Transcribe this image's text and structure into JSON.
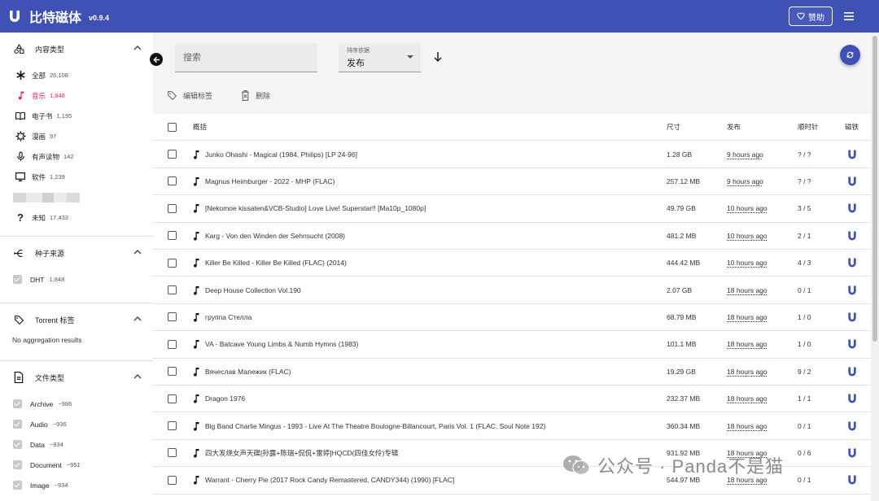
{
  "app": {
    "title": "比特磁体",
    "version": "v0.9.4",
    "sponsor_label": "赞助"
  },
  "sidebar": {
    "content_type": {
      "title": "内容类型",
      "items": [
        {
          "label": "全部",
          "count": "26,108",
          "icon": "asterisk-icon"
        },
        {
          "label": "音乐",
          "count": "1,848",
          "icon": "music-note-icon",
          "active": true
        },
        {
          "label": "电子书",
          "count": "1,195",
          "icon": "book-icon"
        },
        {
          "label": "漫画",
          "count": "97",
          "icon": "comic-icon"
        },
        {
          "label": "有声读物",
          "count": "142",
          "icon": "microphone-icon"
        },
        {
          "label": "软件",
          "count": "1,239",
          "icon": "monitor-icon"
        },
        {
          "label": "未知",
          "count": "17,433",
          "icon": "question-icon"
        }
      ]
    },
    "torrent_source": {
      "title": "种子来源",
      "items": [
        {
          "label": "DHT",
          "count": "1,848"
        }
      ]
    },
    "torrent_tags": {
      "title": "Torrent 标签",
      "empty": "No aggregation results"
    },
    "file_type": {
      "title": "文件类型",
      "items": [
        {
          "label": "Archive",
          "count": "~986"
        },
        {
          "label": "Audio",
          "count": "~936"
        },
        {
          "label": "Data",
          "count": "~934"
        },
        {
          "label": "Document",
          "count": "~951"
        },
        {
          "label": "Image",
          "count": "~934"
        }
      ]
    }
  },
  "search": {
    "placeholder": "搜索"
  },
  "sort": {
    "label": "排序依据",
    "value": "发布"
  },
  "toolbar": {
    "edit_tags": "编辑标签",
    "delete": "删除"
  },
  "table": {
    "headers": {
      "summary": "概括",
      "size": "尺寸",
      "published": "发布",
      "seeders_leechers": "顺时针",
      "magnet": "磁铁"
    },
    "rows": [
      {
        "name": "Junko Ohashi - Magical (1984, Philips) [LP 24-96]",
        "size": "1.28 GB",
        "published": "9 hours ago",
        "sl": "? / ?"
      },
      {
        "name": "Magnus Heimburger - 2022 - MHP (FLAC)",
        "size": "257.12 MB",
        "published": "9 hours ago",
        "sl": "? / ?"
      },
      {
        "name": "[Nekomoe kissaten&VCB-Studio] Love Live! Superstar!! [Ma10p_1080p]",
        "size": "49.79 GB",
        "published": "10 hours ago",
        "sl": "3 / 5"
      },
      {
        "name": "Karg - Von den Winden der Sehnsucht (2008)",
        "size": "481.2 MB",
        "published": "10 hours ago",
        "sl": "2 / 1"
      },
      {
        "name": "Killer Be Killed - Killer Be Killed (FLAC) (2014)",
        "size": "444.42 MB",
        "published": "10 hours ago",
        "sl": "4 / 3"
      },
      {
        "name": "Deep House Collection Vol.190",
        "size": "2.07 GB",
        "published": "18 hours ago",
        "sl": "0 / 1"
      },
      {
        "name": "группа Стелла",
        "size": "68.79 MB",
        "published": "18 hours ago",
        "sl": "1 / 0"
      },
      {
        "name": "VA - Batcave Young Limbs & Numb Hymns (1983)",
        "size": "101.1 MB",
        "published": "18 hours ago",
        "sl": "1 / 0"
      },
      {
        "name": "Вячеслав Малежик (FLAC)",
        "size": "19.29 GB",
        "published": "18 hours ago",
        "sl": "9 / 2"
      },
      {
        "name": "Dragon 1976",
        "size": "232.37 MB",
        "published": "18 hours ago",
        "sl": "1 / 1"
      },
      {
        "name": "Big Band Charlie Mingus - 1993 - Live At The Theatre Boulogne-Billancourt, Paris Vol. 1 (FLAC, Soul Note 192)",
        "size": "360.34 MB",
        "published": "18 hours ago",
        "sl": "0 / 1"
      },
      {
        "name": "四大发烧女声天碟[孙露+陈瑞+侃侃+雷婷]HQCD(四佳女伶)专辑",
        "size": "931.92 MB",
        "published": "18 hours ago",
        "sl": "0 / 6"
      },
      {
        "name": "Warrant - Cherry Pie (2017 Rock Candy Remastered, CANDY344) (1990) [FLAC]",
        "size": "544.97 MB",
        "published": "18 hours ago",
        "sl": "0 / 1"
      }
    ]
  },
  "watermark": "公众号 · Panda不是猫",
  "colors": {
    "primary": "#3f51b5",
    "active": "#e91e63",
    "magnet": "#3f51b5"
  }
}
